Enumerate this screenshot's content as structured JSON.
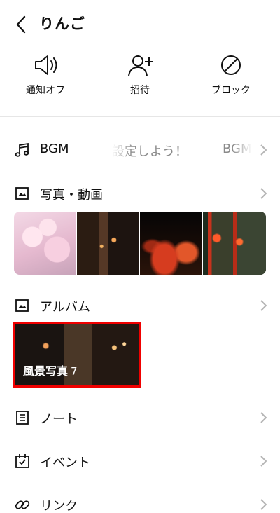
{
  "header": {
    "title": "りんご"
  },
  "actions": [
    {
      "label": "通知オフ",
      "icon": "speaker-icon"
    },
    {
      "label": "招待",
      "icon": "add-user-icon"
    },
    {
      "label": "ブロック",
      "icon": "block-icon"
    }
  ],
  "bgm": {
    "label": "BGM",
    "marquee_a": "設定しよう！",
    "marquee_b": "BGM"
  },
  "photos": {
    "label": "写真・動画"
  },
  "album": {
    "label": "アルバム",
    "card_title": "風景写真",
    "card_count": "7"
  },
  "note": {
    "label": "ノート"
  },
  "event": {
    "label": "イベント"
  },
  "link": {
    "label": "リンク"
  },
  "colors": {
    "highlight_border": "#f00000",
    "divider": "#e6e6e6",
    "chevron": "#b5b5b5"
  }
}
